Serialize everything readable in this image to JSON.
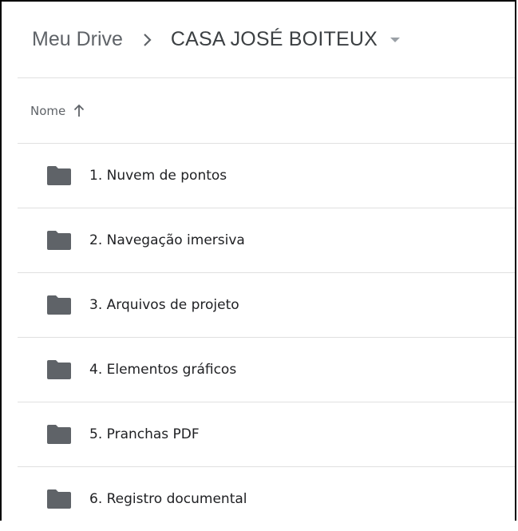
{
  "breadcrumb": {
    "root": "Meu Drive",
    "current": "CASA JOSÉ BOITEUX"
  },
  "columns": {
    "name": "Nome",
    "sort_direction": "ascending"
  },
  "files": [
    {
      "name": "1. Nuvem de pontos",
      "type": "folder"
    },
    {
      "name": "2. Navegação imersiva",
      "type": "folder"
    },
    {
      "name": "3. Arquivos de projeto",
      "type": "folder"
    },
    {
      "name": "4. Elementos gráficos",
      "type": "folder"
    },
    {
      "name": "5. Pranchas PDF",
      "type": "folder"
    },
    {
      "name": "6. Registro documental",
      "type": "folder"
    }
  ],
  "icons": {
    "folder": "folder-icon",
    "breadcrumb_separator": "chevron-right-icon",
    "dropdown": "caret-down-icon",
    "sort": "arrow-up-icon"
  },
  "colors": {
    "folder": "#5f6368",
    "text_primary": "#202124",
    "text_secondary": "#5f6368",
    "divider": "#e0e0e0"
  }
}
